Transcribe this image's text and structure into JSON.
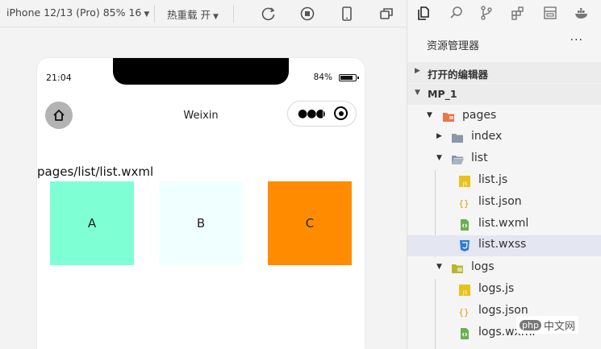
{
  "toolbar": {
    "device_label": "iPhone 12/13 (Pro) 85% 16",
    "reload_label": "热重载 开",
    "icons": [
      "refresh-icon",
      "stop-icon",
      "phone-icon",
      "multi-window-icon"
    ]
  },
  "phone": {
    "time": "21:04",
    "battery": "84%",
    "battery_level": 0.84,
    "nav_title": "Weixin",
    "page_path": "pages/list/list.wxml",
    "boxes": [
      {
        "label": "A",
        "color": "#7fffd4"
      },
      {
        "label": "B",
        "color": "#f0ffff"
      },
      {
        "label": "C",
        "color": "#ff8c00"
      }
    ]
  },
  "explorer": {
    "title": "资源管理器",
    "more": "···",
    "open_editors": "打开的编辑器",
    "project": "MP_1",
    "tree": {
      "pages": "pages",
      "index": "index",
      "list": "list",
      "list_js": "list.js",
      "list_json": "list.json",
      "list_wxml": "list.wxml",
      "list_wxss": "list.wxss",
      "logs": "logs",
      "logs_js": "logs.js",
      "logs_json": "logs.json",
      "logs_wxml": "logs.wxml"
    },
    "icons": [
      "files-icon",
      "search-icon",
      "source-control-icon",
      "extensions-icon",
      "layout-icon",
      "docker-icon"
    ]
  },
  "watermark": {
    "badge": "php",
    "text": "中文网"
  },
  "colors": {
    "accent_selected": "#e4e6f1",
    "js": "#e8c21c",
    "wxml": "#6ab04c",
    "wxss": "#2e7bd6"
  }
}
